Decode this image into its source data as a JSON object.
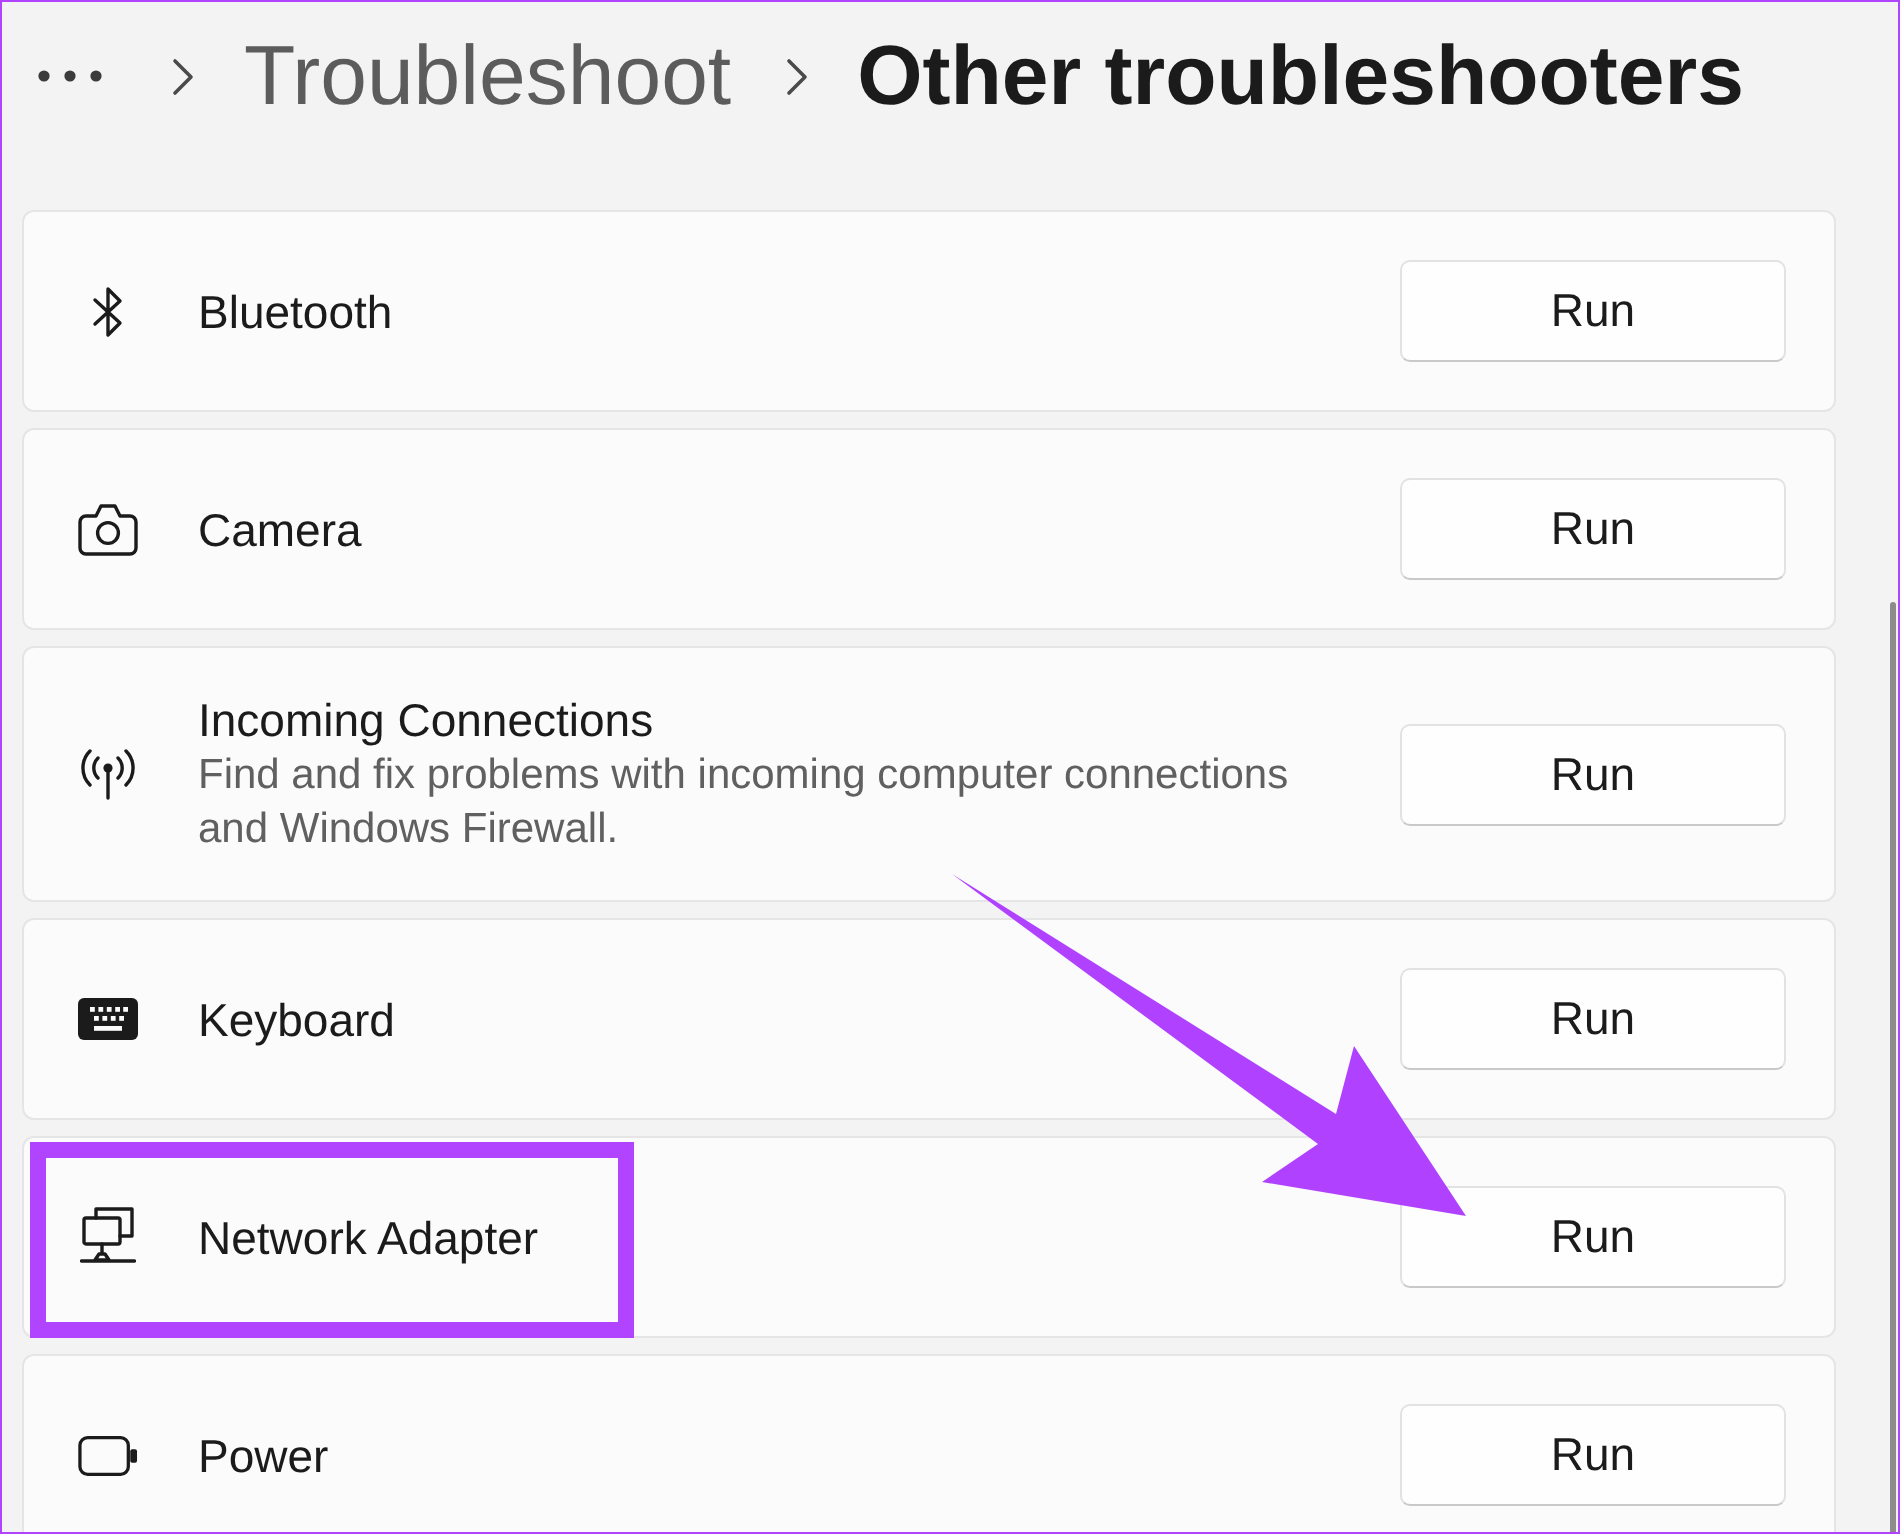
{
  "breadcrumb": [
    {
      "label": "Troubleshoot",
      "current": false
    },
    {
      "label": "Other troubleshooters",
      "current": true
    }
  ],
  "troubleshooters": [
    {
      "title": "Bluetooth",
      "button": "Run",
      "highlighted": false
    },
    {
      "title": "Camera",
      "button": "Run",
      "highlighted": false
    },
    {
      "title": "Incoming Connections",
      "description": "Find and fix problems with incoming computer connections and Windows Firewall.",
      "button": "Run",
      "highlighted": false
    },
    {
      "title": "Keyboard",
      "button": "Run",
      "highlighted": false
    },
    {
      "title": "Network Adapter",
      "button": "Run",
      "highlighted": true
    },
    {
      "title": "Power",
      "button": "Run",
      "highlighted": false
    }
  ],
  "annotation_arrow": true
}
